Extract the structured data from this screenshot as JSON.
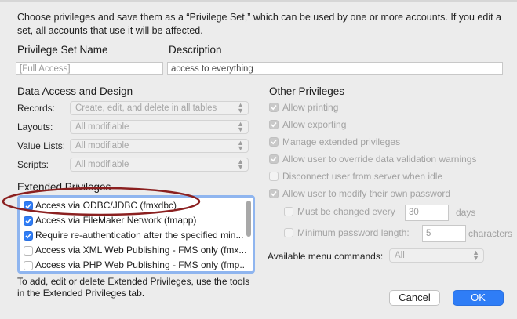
{
  "intro_text": "Choose privileges and save them as a “Privilege Set,” which can be used by one or more accounts. If you edit a set, all accounts that use it will be affected.",
  "privilege_set_name": {
    "label": "Privilege Set Name",
    "value": "[Full Access]"
  },
  "description": {
    "label": "Description",
    "value": "access to everything"
  },
  "data_access": {
    "heading": "Data Access and Design",
    "records": {
      "label": "Records:",
      "value": "Create, edit, and delete in all tables"
    },
    "layouts": {
      "label": "Layouts:",
      "value": "All modifiable"
    },
    "value_lists": {
      "label": "Value Lists:",
      "value": "All modifiable"
    },
    "scripts": {
      "label": "Scripts:",
      "value": "All modifiable"
    }
  },
  "extended": {
    "heading": "Extended Privileges",
    "items": [
      {
        "label": "Access via ODBC/JDBC (fmxdbc)",
        "checked": true
      },
      {
        "label": "Access via FileMaker Network (fmapp)",
        "checked": true
      },
      {
        "label": "Require re-authentication after the specified min...",
        "checked": true
      },
      {
        "label": "Access via XML Web Publishing - FMS only (fmx...",
        "checked": false
      },
      {
        "label": "Access via PHP Web Publishing - FMS only (fmp...",
        "checked": false
      }
    ],
    "help_text": "To add, edit or delete Extended Privileges, use the tools in the Extended Privileges tab."
  },
  "other": {
    "heading": "Other Privileges",
    "allow_printing": "Allow printing",
    "allow_exporting": "Allow exporting",
    "manage_extended": "Manage extended privileges",
    "allow_override": "Allow user to override data validation warnings",
    "disconnect_idle": "Disconnect user from server when idle",
    "modify_password": "Allow user to modify their own password",
    "must_change": {
      "label": "Must be changed every",
      "value": "30",
      "unit": "days"
    },
    "min_length": {
      "label": "Minimum password length:",
      "value": "5",
      "unit": "characters"
    },
    "menu_commands": {
      "label": "Available menu commands:",
      "value": "All"
    }
  },
  "buttons": {
    "cancel": "Cancel",
    "ok": "OK"
  },
  "colors": {
    "accent": "#2f7df6",
    "annotation": "#8b2020"
  }
}
